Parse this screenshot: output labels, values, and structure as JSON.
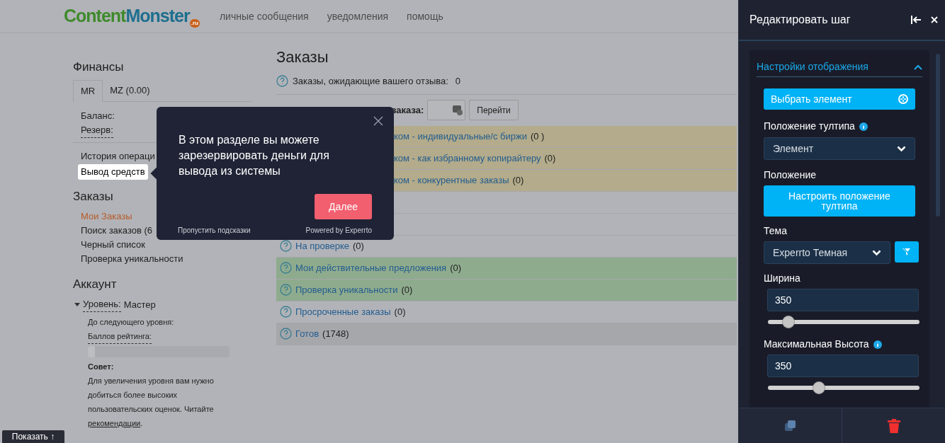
{
  "header": {
    "logo": {
      "part_1": "Content",
      "part_2": "Monster",
      "badge": ".ru"
    },
    "nav": [
      "личные сообщения",
      "уведомления",
      "помощь"
    ]
  },
  "sidebar": {
    "finance": {
      "title": "Финансы",
      "tabs": [
        {
          "label": "MR",
          "selected": true
        },
        {
          "label": "MZ (0.00)",
          "selected": false
        }
      ],
      "fields": [
        "Баланс:",
        "Резерв:"
      ],
      "links": [
        {
          "label": "История операци",
          "highlighted": false
        },
        {
          "label": "Вывод средств",
          "highlighted": true
        }
      ]
    },
    "orders": {
      "title": "Заказы",
      "items": [
        {
          "label": "Мои Заказы",
          "selected": true
        },
        {
          "label": "Поиск заказов (6",
          "selected": false
        },
        {
          "label": "Черный список",
          "selected": false
        },
        {
          "label": "Проверка уникальности",
          "selected": false
        }
      ]
    },
    "account": {
      "title": "Аккаунт",
      "level_label": "Уровень:",
      "level_value": "Мастер",
      "expanded": true,
      "next_level": "До следующего уровня:",
      "rating_label": "Баллов рейтинга:",
      "rating": {
        "level": 0.05
      },
      "tip_title": "Совет:",
      "tip_text": "Для увеличения уровня вам нужно добиться более высоких пользовательских оценок. Читайте",
      "tip_link": "рекомендации",
      "tip_end": "."
    }
  },
  "main": {
    "title": "Заказы",
    "awaiting_label": "Заказы, ожидающие вашего отзыва:",
    "awaiting_value": "0",
    "search_label": "заказа:",
    "search_button": "Перейти",
    "rows": [
      {
        "kind": "partial",
        "color": "#b3ab8b",
        "link": "ком - индивидуальные/с биржи",
        "count": "(0 )"
      },
      {
        "kind": "partial",
        "color": "#b3ab8b",
        "link": "ком - как избранному копирайтеру",
        "count": "(0)"
      },
      {
        "kind": "partial",
        "color": "#b3ab8b",
        "link": "ком - конкурентные заказы",
        "count": "(0)"
      },
      {
        "kind": "hidden",
        "color": "#b2b3b8"
      },
      {
        "kind": "hidden",
        "color": "#b2b3b8"
      },
      {
        "kind": "full",
        "color": "#b2b3b8",
        "link": "На проверке",
        "count": "(0)"
      },
      {
        "kind": "full",
        "color": "#8fab8e",
        "link": "Мои действительные предложения",
        "count": "(0)"
      },
      {
        "kind": "full",
        "color": "#8fab8e",
        "link": "Проверка уникальности",
        "count": "(0)"
      },
      {
        "kind": "full",
        "color": "#b2b3b8",
        "link": "Просроченные заказы",
        "count": "(0)"
      },
      {
        "kind": "full",
        "color": "#a6a7ab",
        "link": "Готов",
        "count": "(1748)"
      }
    ]
  },
  "tooltip": {
    "text": "В этом разделе вы можете зарезервировать деньги для вывода из системы",
    "next_button": "Далее",
    "skip_link": "Пропустить подсказки",
    "powered": "Powered by Experrto"
  },
  "show_button": "Показать ↑",
  "editor": {
    "title": "Редактировать шаг",
    "section": {
      "title": "Настройки отображения",
      "expanded": true,
      "select_button": "Выбрать элемент",
      "position_label": "Положение тултипа",
      "position_value": "Элемент",
      "placement_label": "Положение",
      "placement_button": "Настроить положение тултипа",
      "theme_label": "Тема",
      "theme_value": "Experrto Темная",
      "width_label": "Ширина",
      "width_value": "350",
      "width_slider": {
        "level": 0.1
      },
      "height_label": "Максимальная Высота",
      "height_value": "350",
      "height_slider": {
        "level": 0.32
      }
    }
  }
}
